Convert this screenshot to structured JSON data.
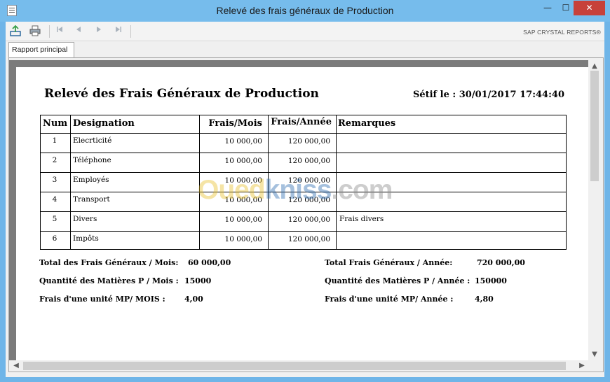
{
  "window": {
    "title": "Relevé des frais généraux de Production",
    "minimize": "—",
    "maximize": "☐",
    "close": "✕"
  },
  "toolbar": {
    "export_icon": "export-icon",
    "print_icon": "print-icon",
    "nav": [
      "first-page-icon",
      "previous-page-icon",
      "next-page-icon",
      "last-page-icon"
    ],
    "brand": "SAP CRYSTAL REPORTS®"
  },
  "tab": {
    "label": "Rapport principal"
  },
  "report": {
    "title": "Relevé des Frais Généraux de Production",
    "date": "Sétif le : 30/01/2017 17:44:40",
    "columns": [
      "Num",
      "Designation",
      "Frais/Mois",
      "Frais/Année",
      "Remarques"
    ],
    "rows": [
      {
        "num": "1",
        "designation": "Elecrticité",
        "frais_mois": "10 000,00",
        "frais_annee": "120 000,00",
        "remarques": ""
      },
      {
        "num": "2",
        "designation": "Téléphone",
        "frais_mois": "10 000,00",
        "frais_annee": "120 000,00",
        "remarques": ""
      },
      {
        "num": "3",
        "designation": "Employés",
        "frais_mois": "10 000,00",
        "frais_annee": "120 000,00",
        "remarques": ""
      },
      {
        "num": "4",
        "designation": "Transport",
        "frais_mois": "10 000,00",
        "frais_annee": "120 000,00",
        "remarques": ""
      },
      {
        "num": "5",
        "designation": "Divers",
        "frais_mois": "10 000,00",
        "frais_annee": "120 000,00",
        "remarques": "Frais divers"
      },
      {
        "num": "6",
        "designation": "Impôts",
        "frais_mois": "10 000,00",
        "frais_annee": "120 000,00",
        "remarques": ""
      }
    ],
    "summary_left": [
      {
        "label": "Total des Frais Généraux / Mois:",
        "value": "60 000,00"
      },
      {
        "label": "Quantité  des Matières P / Mois :",
        "value": "15000"
      },
      {
        "label": "Frais d'une unité MP/  MOIS :",
        "value": "4,00"
      }
    ],
    "summary_right": [
      {
        "label": "Total Frais Généraux / Année:",
        "value": "720 000,00"
      },
      {
        "label": "Quantité  des Matières P / Année :",
        "value": "150000"
      },
      {
        "label": "Frais d'une unité MP/  Année :",
        "value": "4,80"
      }
    ]
  },
  "watermark": {
    "part1": "Oued",
    "part2": "kniss",
    "part3": ".com"
  }
}
